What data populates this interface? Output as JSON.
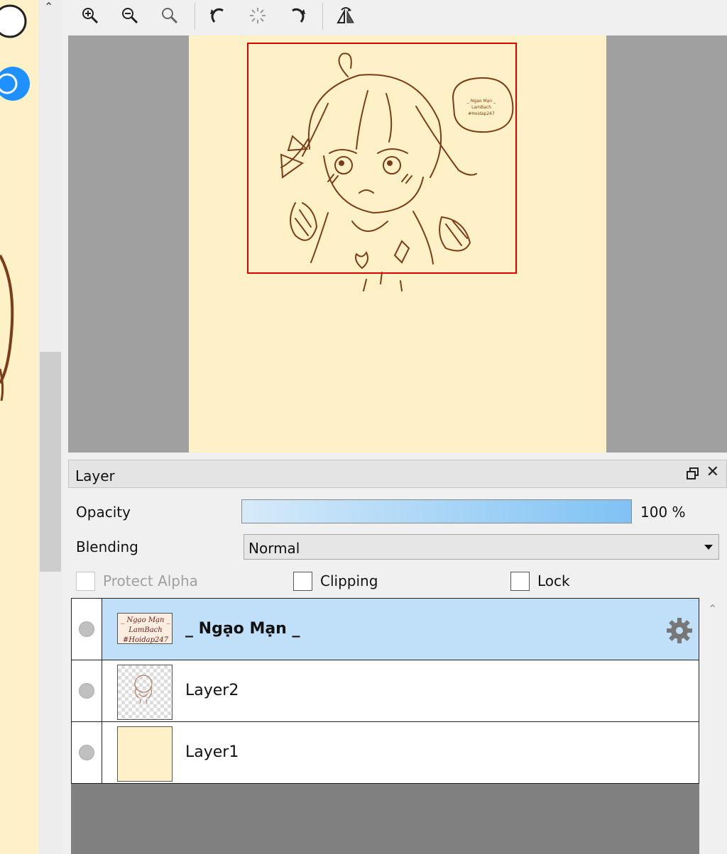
{
  "layer_panel": {
    "title": "Layer",
    "opacity_label": "Opacity",
    "opacity_value": "100 %",
    "opacity_fraction": 1.0,
    "blending_label": "Blending",
    "blending_value": "Normal",
    "protect_alpha_label": "Protect Alpha",
    "clipping_label": "Clipping",
    "lock_label": "Lock",
    "layers": [
      {
        "name": "_ Ngạo Mạn _",
        "selected": true
      },
      {
        "name": "Layer2",
        "selected": false
      },
      {
        "name": "Layer1",
        "selected": false
      }
    ],
    "thumb_text": [
      "_ Ngạo Mạn _",
      "LamBach",
      "#Hoidap247"
    ]
  },
  "navigator": {
    "speech_bubble_text": [
      "_ Ngạo Mạn _",
      "LamBach",
      "#Hoidap247"
    ]
  },
  "colors": {
    "canvas": "#fef0c7",
    "line_art": "#7a3d1a",
    "selection": "#bfe0f8",
    "viewport_frame": "#e00000"
  }
}
